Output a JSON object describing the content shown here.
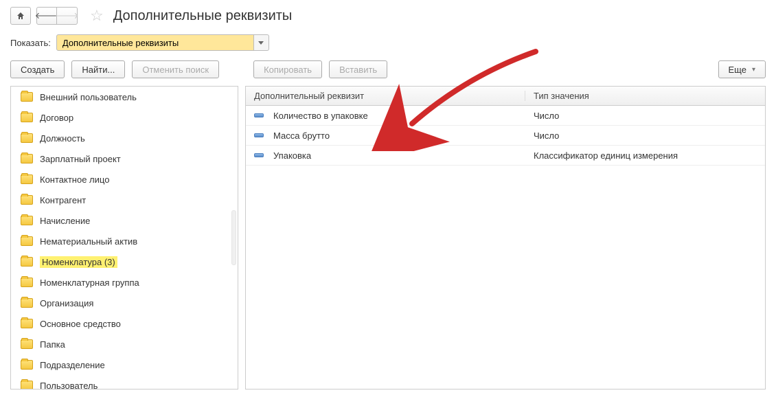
{
  "title": "Дополнительные реквизиты",
  "filter": {
    "label": "Показать:",
    "value": "Дополнительные реквизиты"
  },
  "toolbar": {
    "create": "Создать",
    "find": "Найти...",
    "cancel_search": "Отменить поиск",
    "copy": "Копировать",
    "paste": "Вставить",
    "more": "Еще"
  },
  "tree": {
    "items": [
      {
        "label": "Внешний пользователь",
        "selected": false
      },
      {
        "label": "Договор",
        "selected": false
      },
      {
        "label": "Должность",
        "selected": false
      },
      {
        "label": "Зарплатный проект",
        "selected": false
      },
      {
        "label": "Контактное лицо",
        "selected": false
      },
      {
        "label": "Контрагент",
        "selected": false
      },
      {
        "label": "Начисление",
        "selected": false
      },
      {
        "label": "Нематериальный актив",
        "selected": false
      },
      {
        "label": "Номенклатура (3)",
        "selected": true
      },
      {
        "label": "Номенклатурная группа",
        "selected": false
      },
      {
        "label": "Организация",
        "selected": false
      },
      {
        "label": "Основное средство",
        "selected": false
      },
      {
        "label": "Папка",
        "selected": false
      },
      {
        "label": "Подразделение",
        "selected": false
      },
      {
        "label": "Пользователь",
        "selected": false
      }
    ]
  },
  "table": {
    "headers": {
      "requisite": "Дополнительный реквизит",
      "type": "Тип значения"
    },
    "rows": [
      {
        "name": "Количество в упаковке",
        "type": "Число"
      },
      {
        "name": "Масса брутто",
        "type": "Число"
      },
      {
        "name": "Упаковка",
        "type": "Классификатор единиц измерения"
      }
    ]
  }
}
